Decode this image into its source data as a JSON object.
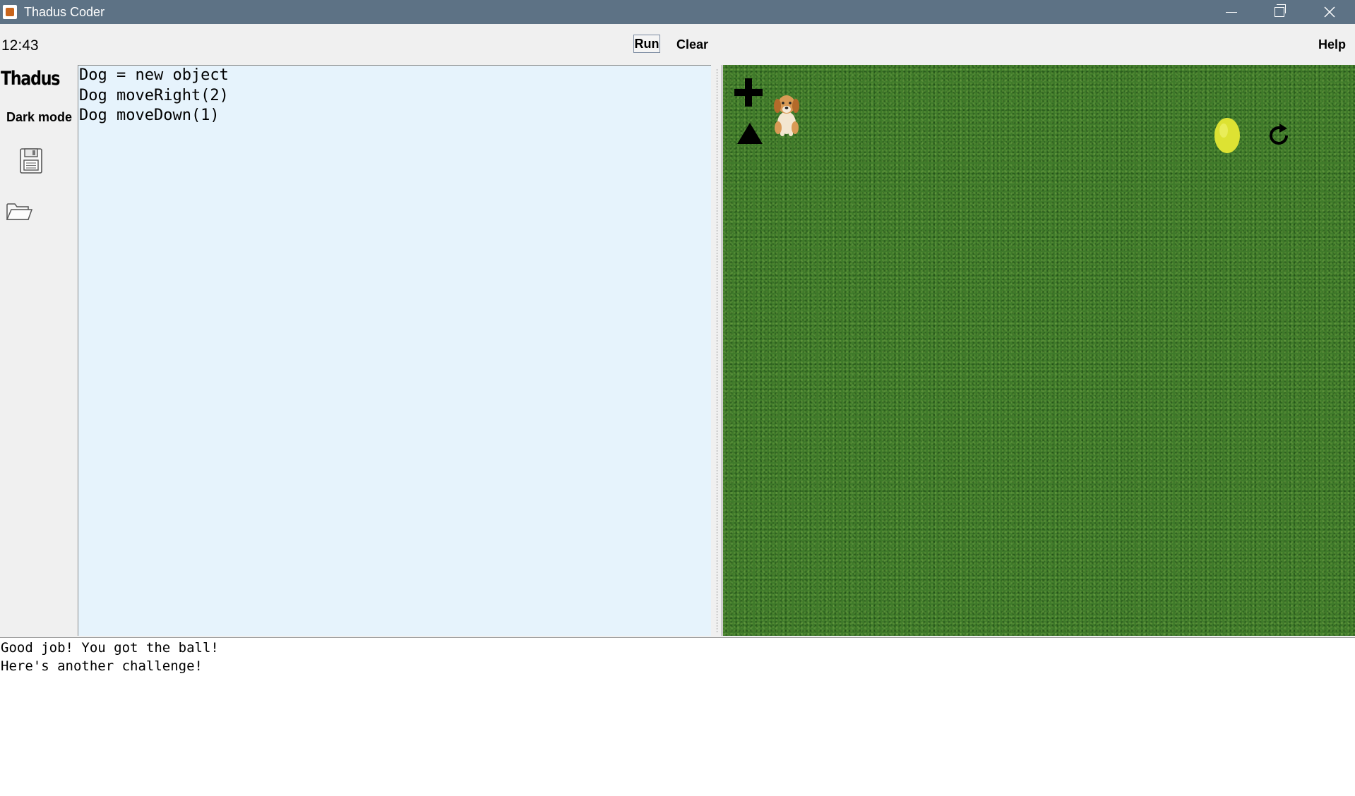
{
  "window": {
    "title": "Thadus Coder",
    "app_icon": "java-cup-icon",
    "controls": [
      "minimize-icon",
      "restore-icon",
      "close-icon"
    ]
  },
  "toolbar": {
    "clock": "12:43",
    "run_label": "Run",
    "clear_label": "Clear",
    "help_label": "Help"
  },
  "sidebar": {
    "logo": "Thadus",
    "dark_mode_label": "Dark mode",
    "icons": [
      "save-floppy-icon",
      "open-folder-icon"
    ]
  },
  "editor": {
    "lines": [
      "Dog = new object",
      "Dog moveRight(2)",
      "Dog moveDown(1)"
    ]
  },
  "canvas": {
    "background": "grass",
    "icons": [
      "plus-icon",
      "triangle-up-icon",
      "dog-sprite",
      "tennis-ball-sprite",
      "refresh-icon"
    ]
  },
  "console": {
    "lines": [
      "Good job! You got the ball!",
      "Here's another challenge!"
    ]
  },
  "colors": {
    "titlebar": "#5d7285",
    "editor_bg": "#e6f3fc",
    "canvas_grass": "#3f7a2a",
    "ball": "#dde233"
  }
}
